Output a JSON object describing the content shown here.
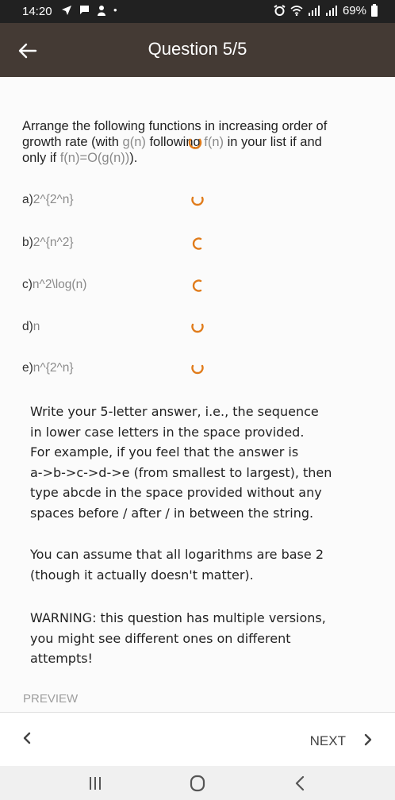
{
  "status_bar": {
    "time": "14:20",
    "battery": "69%"
  },
  "header": {
    "title": "Question 5/5"
  },
  "question": {
    "line1": "Arrange the following functions in increasing order of",
    "line2_a": "growth rate (with ",
    "line2_g": "g(n)",
    "line2_b": " following ",
    "line2_f": "f(n)",
    "line2_c": " in your list if and",
    "line3_a": "only if ",
    "line3_math": "f(n)=O(g(n))",
    "line3_b": ")."
  },
  "options": [
    {
      "letter": "a)",
      "expr": "2^{2^n}"
    },
    {
      "letter": "b)",
      "expr": "2^{n^2}"
    },
    {
      "letter": "c)",
      "expr": "n^2\\log(n)"
    },
    {
      "letter": "d)",
      "expr": "n"
    },
    {
      "letter": "e)",
      "expr": "n^{2^n}"
    }
  ],
  "instructions": {
    "p1": [
      "Write your 5-letter answer, i.e., the sequence",
      "in lower case letters in the space provided.",
      "For example, if you feel that the answer is",
      "a->b->c->d->e (from smallest to largest), then",
      "type abcde in the space provided without any",
      "spaces before / after / in between the string."
    ],
    "p2": [
      "You can assume that all logarithms are base 2",
      "(though it actually doesn't matter)."
    ],
    "p3": [
      "WARNING: this question has multiple versions,",
      "you might see different ones on different",
      "attempts!"
    ]
  },
  "preview_label": "PREVIEW",
  "footer": {
    "next_label": "NEXT"
  },
  "colors": {
    "app_bar": "#443a34",
    "status_bar": "#212121",
    "spinner": "#e07b1a"
  }
}
